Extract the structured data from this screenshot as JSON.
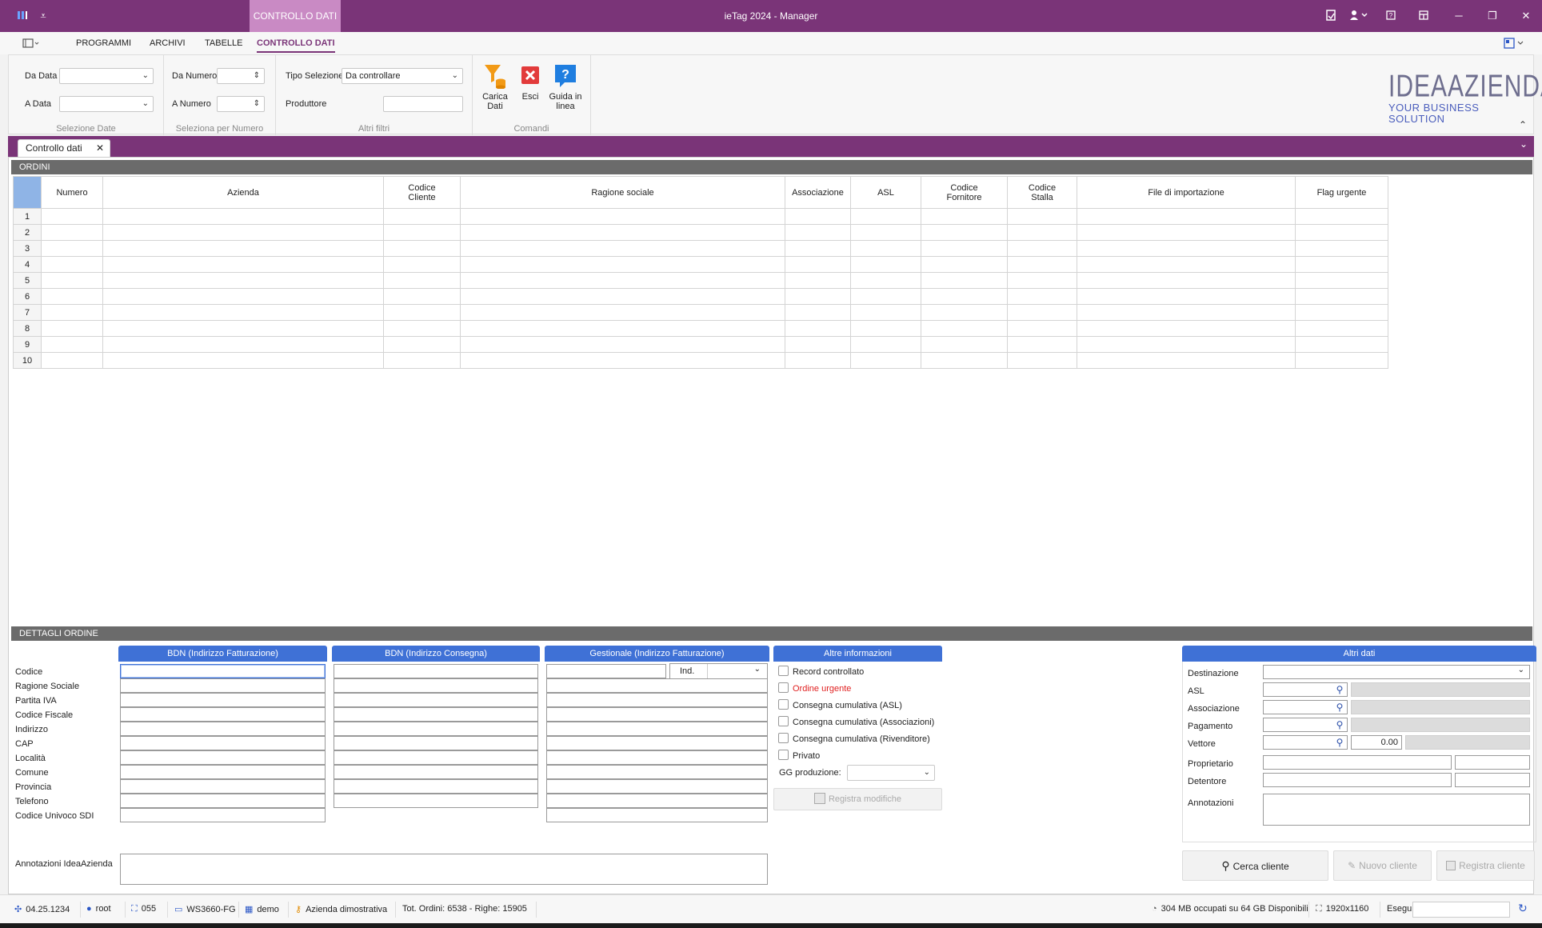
{
  "titlebar": {
    "title": "ieTag 2024 - Manager",
    "context_tab": "CONTROLLO DATI",
    "accent": "#7a3478"
  },
  "menu": {
    "items": [
      "PROGRAMMI",
      "ARCHIVI",
      "TABELLE",
      "CONTROLLO DATI"
    ],
    "active": "CONTROLLO DATI"
  },
  "ribbon": {
    "date_group": {
      "from_label": "Da Data",
      "to_label": "A Data",
      "from_value": "",
      "to_value": "",
      "caption": "Selezione Date"
    },
    "number_group": {
      "from_label": "Da Numero",
      "to_label": "A Numero",
      "from_value": "",
      "to_value": "",
      "caption": "Seleziona per Numero"
    },
    "filter_group": {
      "type_label": "Tipo Selezione",
      "type_value": "Da controllare",
      "producer_label": "Produttore",
      "producer_value": "",
      "caption": "Altri filtri"
    },
    "commands": {
      "caption": "Comandi",
      "load_label_1": "Carica",
      "load_label_2": "Dati",
      "exit_label": "Esci",
      "help_label_1": "Guida in",
      "help_label_2": "linea"
    },
    "logo_line_1": "IDEAAZIENDA",
    "logo_line_2": "YOUR BUSINESS SOLUTION"
  },
  "document_tab": {
    "label": "Controllo dati"
  },
  "orders": {
    "section_title": "ORDINI",
    "columns": [
      "Numero",
      "Azienda",
      "Codice Cliente",
      "Ragione sociale",
      "Associazione",
      "ASL",
      "Codice Fornitore",
      "Codice Stalla",
      "File di importazione",
      "Flag urgente"
    ],
    "row_numbers": [
      "1",
      "2",
      "3",
      "4",
      "5",
      "6",
      "7",
      "8",
      "9",
      "10"
    ]
  },
  "details": {
    "section_title": "DETTAGLI ORDINE",
    "field_labels": [
      "Codice",
      "Ragione Sociale",
      "Partita IVA",
      "Codice Fiscale",
      "Indirizzo",
      "CAP",
      "Località",
      "Comune",
      "Provincia",
      "Telefono",
      "Codice Univoco SDI"
    ],
    "panel_billing": "BDN (Indirizzo Fatturazione)",
    "panel_delivery": "BDN (Indirizzo Consegna)",
    "panel_management": "Gestionale (Indirizzo Fatturazione)",
    "ind_label": "Ind.",
    "panel_other": "Altre informazioni",
    "checkboxes": [
      "Record controllato",
      "Ordine urgente",
      "Consegna cumulativa (ASL)",
      "Consegna cumulativa (Associazioni)",
      "Consegna cumulativa (Rivenditore)",
      "Privato"
    ],
    "gg_label": "GG produzione:",
    "save_changes": "Registra modifiche",
    "notes_label": "Annotazioni IdeaAzienda",
    "panel_extra": "Altri dati",
    "extra_labels": {
      "destinazione": "Destinazione",
      "asl": "ASL",
      "associazione": "Associazione",
      "pagamento": "Pagamento",
      "vettore": "Vettore",
      "proprietario": "Proprietario",
      "detentore": "Detentore",
      "annotazioni": "Annotazioni"
    },
    "vettore_amount": "0.00",
    "buttons": {
      "search": "Cerca cliente",
      "new": "Nuovo cliente",
      "save": "Registra cliente"
    },
    "header_color": "#3f71d6"
  },
  "statusbar": {
    "version": "04.25.1234",
    "user": "root",
    "code": "055",
    "workstation": "WS3660-FG",
    "db": "demo",
    "company": "Azienda dimostrativa",
    "totals": "Tot. Ordini: 6538 - Righe: 15905",
    "memory": "304 MB occupati su 64 GB Disponibili",
    "resolution": "1920x1160",
    "run_label": "Esegui"
  }
}
